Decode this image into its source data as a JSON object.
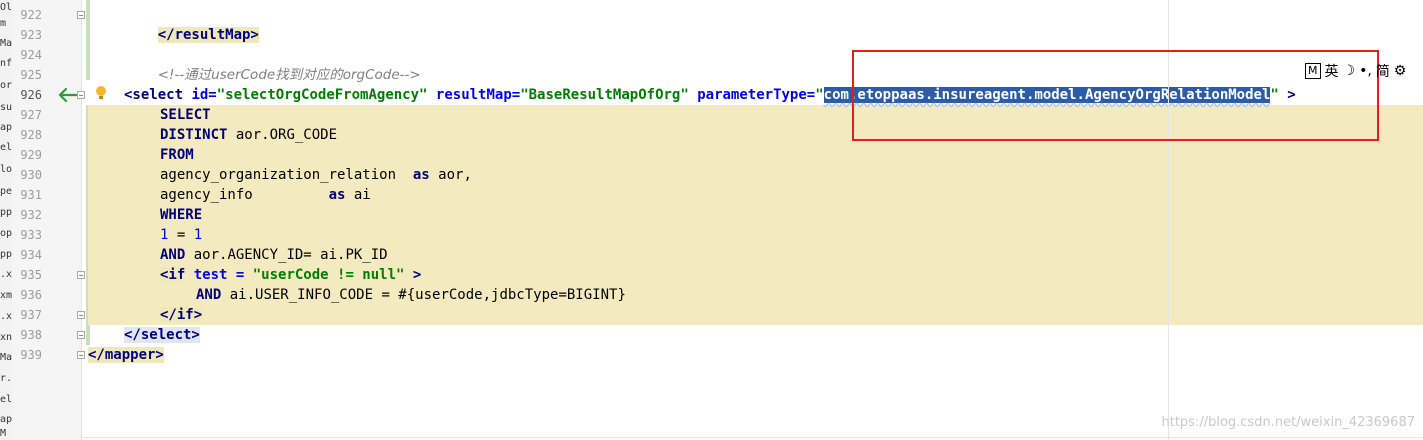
{
  "file_strip": [
    "Ol",
    "m",
    "Ma",
    "nfo",
    "or",
    "su",
    "ap",
    "el",
    "lo",
    "pe",
    "pp",
    "op",
    "pp",
    ".xn",
    "xm",
    ".xn",
    "xn",
    "Ma",
    "r.x",
    "el",
    "ap",
    "M"
  ],
  "line_numbers": [
    "922",
    "923",
    "924",
    "925",
    "926",
    "927",
    "928",
    "929",
    "930",
    "931",
    "932",
    "933",
    "934",
    "935",
    "936",
    "937",
    "938",
    "939"
  ],
  "code": {
    "l922": {
      "tag": "</resultMap>"
    },
    "l924": {
      "comment": "<!--通过userCode找到对应的orgCode-->"
    },
    "l926": {
      "open": "<select",
      "attr_id": "id=",
      "val_id": "\"selectOrgCodeFromAgency\"",
      "attr_rm": "resultMap=",
      "val_rm": "\"BaseResultMapOfOrg\"",
      "attr_pt": "parameterType=",
      "quote_open": "\"",
      "val_pt": "com.etoppaas.insureagent.model.AgencyOrgRelationModel",
      "quote_close": "\"",
      "close": " >"
    },
    "l927": {
      "kw": "SELECT"
    },
    "l928": {
      "kw": "DISTINCT",
      "rest": " aor.ORG_CODE"
    },
    "l929": {
      "kw": "FROM"
    },
    "l930": {
      "text": "agency_organization_relation  ",
      "kw": "as",
      "rest": " aor,"
    },
    "l931": {
      "text": "agency_info         ",
      "kw": "as",
      "rest": " ai"
    },
    "l932": {
      "kw": "WHERE"
    },
    "l933": {
      "n1": "1",
      "eq": " = ",
      "n2": "1"
    },
    "l934": {
      "kw": "AND",
      "rest": " aor.AGENCY_ID= ai.PK_ID"
    },
    "l935": {
      "open": "<if",
      "attr": " test = ",
      "val": "\"userCode != null\"",
      "close": " >"
    },
    "l936": {
      "kw": "AND",
      "rest": " ai.USER_INFO_CODE = #{userCode,jdbcType=BIGINT}"
    },
    "l937": {
      "tag": "</if>"
    },
    "l938": {
      "tag": "</select>"
    },
    "l939": {
      "tag": "</mapper>"
    }
  },
  "ime_bar": {
    "mode_box": "M",
    "lang": "英",
    "moon": "☽",
    "punct": "•,",
    "simp": "简",
    "gear": "⚙"
  },
  "watermark": "https://blog.csdn.net/weixin_42369687",
  "colors": {
    "highlight": "#f4eabf",
    "selection": "#2c5ba8",
    "red_box": "#e0201b",
    "tag": "#000080",
    "string": "#008000"
  }
}
